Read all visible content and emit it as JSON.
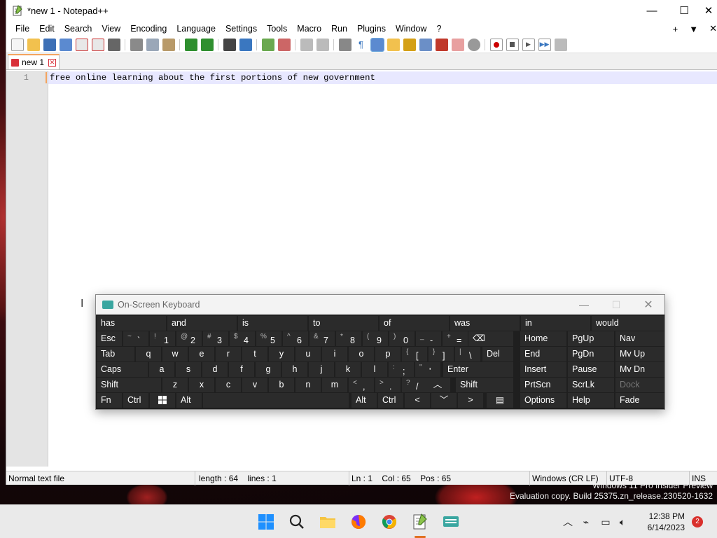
{
  "window": {
    "title": "*new 1 - Notepad++"
  },
  "menu": {
    "items": [
      "File",
      "Edit",
      "Search",
      "View",
      "Encoding",
      "Language",
      "Settings",
      "Tools",
      "Macro",
      "Run",
      "Plugins",
      "Window",
      "?"
    ],
    "right": {
      "plus": "+",
      "dropdown": "▼",
      "close": "✕"
    }
  },
  "tab": {
    "label": "new 1"
  },
  "editor": {
    "line_number": "1",
    "text": "free online learning about the first portions of new government"
  },
  "status": {
    "filetype": "Normal text file",
    "length": "length : 64",
    "lines": "lines : 1",
    "ln": "Ln : 1",
    "col": "Col : 65",
    "pos": "Pos : 65",
    "eol": "Windows (CR LF)",
    "encoding": "UTF-8",
    "mode": "INS"
  },
  "osk": {
    "title": "On-Screen Keyboard",
    "predictions": [
      "has",
      "and",
      "is",
      "to",
      "of",
      "was",
      "in",
      "would"
    ],
    "row1": {
      "esc": "Esc",
      "del": "Del"
    },
    "row2": {
      "tab": "Tab"
    },
    "row3": {
      "caps": "Caps",
      "enter": "Enter"
    },
    "row4": {
      "shift_left": "Shift",
      "shift_right": "Shift"
    },
    "row5": {
      "fn": "Fn",
      "ctrl_left": "Ctrl",
      "alt_left": "Alt",
      "alt_right": "Alt",
      "ctrl_right": "Ctrl"
    },
    "nav": {
      "home": "Home",
      "pgup": "PgUp",
      "nav": "Nav",
      "end": "End",
      "pgdn": "PgDn",
      "mvup": "Mv Up",
      "insert": "Insert",
      "pause": "Pause",
      "mvdn": "Mv Dn",
      "prtscn": "PrtScn",
      "scrlk": "ScrLk",
      "dock": "Dock",
      "options": "Options",
      "help": "Help",
      "fade": "Fade"
    },
    "numkeys": [
      {
        "sub": "~",
        "main": "`"
      },
      {
        "sub": "!",
        "main": "1"
      },
      {
        "sub": "@",
        "main": "2"
      },
      {
        "sub": "#",
        "main": "3"
      },
      {
        "sub": "$",
        "main": "4"
      },
      {
        "sub": "%",
        "main": "5"
      },
      {
        "sub": "^",
        "main": "6"
      },
      {
        "sub": "&",
        "main": "7"
      },
      {
        "sub": "*",
        "main": "8"
      },
      {
        "sub": "(",
        "main": "9"
      },
      {
        "sub": ")",
        "main": "0"
      },
      {
        "sub": "_",
        "main": "-"
      },
      {
        "sub": "+",
        "main": "="
      }
    ],
    "qrow": [
      "q",
      "w",
      "e",
      "r",
      "t",
      "y",
      "u",
      "i",
      "o",
      "p"
    ],
    "qrow_sym": [
      {
        "sub": "{",
        "main": "["
      },
      {
        "sub": "}",
        "main": "]"
      },
      {
        "sub": "|",
        "main": "\\"
      }
    ],
    "arow": [
      "a",
      "s",
      "d",
      "f",
      "g",
      "h",
      "j",
      "k",
      "l"
    ],
    "arow_sym": [
      {
        "sub": ":",
        "main": ";"
      },
      {
        "sub": "\"",
        "main": "'"
      }
    ],
    "zrow": [
      "z",
      "x",
      "c",
      "v",
      "b",
      "n",
      "m"
    ],
    "zrow_sym": [
      {
        "sub": "<",
        "main": ","
      },
      {
        "sub": ">",
        "main": "."
      },
      {
        "sub": "?",
        "main": "/"
      }
    ]
  },
  "desktop": {
    "watermark_line1": "Windows 11 Pro Insider Preview",
    "watermark_line2": "Evaluation copy. Build 25375.zn_release.230520-1632"
  },
  "taskbar": {
    "time": "12:38 PM",
    "date": "6/14/2023",
    "notifications": "2"
  },
  "colors": {
    "accent": "#f4a460",
    "osk_bg": "#1f1f1f",
    "osk_key": "#2b2b2b"
  }
}
